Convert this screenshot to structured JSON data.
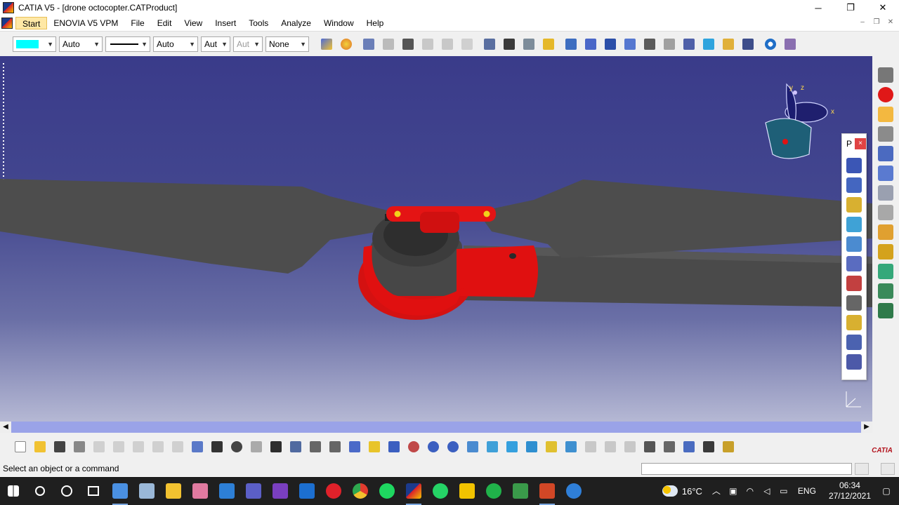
{
  "window": {
    "title": "CATIA V5 - [drone octocopter.CATProduct]",
    "minimize": "─",
    "maximize": "❐",
    "close": "✕"
  },
  "menu": {
    "items": [
      "Start",
      "ENOVIA V5 VPM",
      "File",
      "Edit",
      "View",
      "Insert",
      "Tools",
      "Analyze",
      "Window",
      "Help"
    ],
    "doc_controls": [
      "–",
      "❐",
      "✕"
    ]
  },
  "toolbar1": {
    "linetype_value": "Auto",
    "thickness_value": "Auto",
    "layer_value": "Aut",
    "layer2_value": "Aut",
    "filter_value": "None"
  },
  "viewport": {
    "compass_axes": [
      "y",
      "z",
      "x"
    ],
    "model": "drone octocopter"
  },
  "float_panel": {
    "title": "P",
    "close": "×"
  },
  "status": {
    "text": "Select an object or a command"
  },
  "brand": {
    "label": "CATIA"
  },
  "taskbar": {
    "temperature": "16°C",
    "language": "ENG",
    "time": "06:34",
    "date": "27/12/2021"
  },
  "colors": {
    "viewport_top": "#3a3b8a",
    "viewport_bottom": "#b5b8d4",
    "part_red": "#e10e0e",
    "part_gray": "#4a4a4a",
    "highlight": "#00ffff"
  }
}
